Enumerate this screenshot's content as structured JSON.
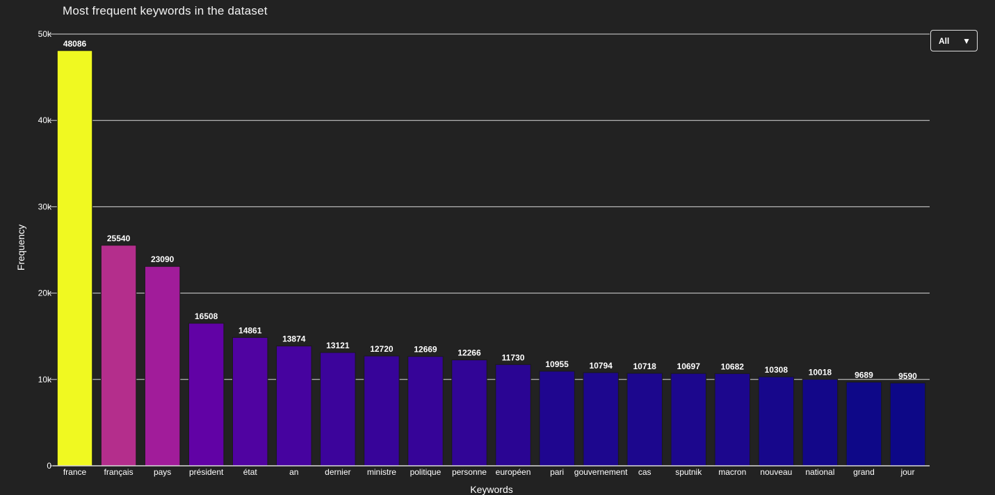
{
  "page": {
    "title": "Most frequent keywords in the dataset"
  },
  "filter": {
    "selected": "All",
    "icon": "chevron-down-icon"
  },
  "chart_data": {
    "type": "bar",
    "title": "Most frequent keywords in the dataset",
    "xlabel": "Keywords",
    "ylabel": "Frequency",
    "ylim": [
      0,
      50000
    ],
    "yticks": [
      0,
      10000,
      20000,
      30000,
      40000,
      50000
    ],
    "ytick_labels": [
      "0",
      "10k",
      "20k",
      "30k",
      "40k",
      "50k"
    ],
    "grid": true,
    "categories": [
      "france",
      "français",
      "pays",
      "président",
      "état",
      "an",
      "dernier",
      "ministre",
      "politique",
      "personne",
      "européen",
      "pari",
      "gouvernement",
      "cas",
      "sputnik",
      "macron",
      "nouveau",
      "national",
      "grand",
      "jour"
    ],
    "values": [
      48086,
      25540,
      23090,
      16508,
      14861,
      13874,
      13121,
      12720,
      12669,
      12266,
      11730,
      10955,
      10794,
      10718,
      10697,
      10682,
      10308,
      10018,
      9689,
      9590
    ],
    "colorscale": "plasma",
    "colors": {
      "background": "#222222",
      "grid": "#d9d9d9",
      "text": "#ffffff"
    }
  }
}
